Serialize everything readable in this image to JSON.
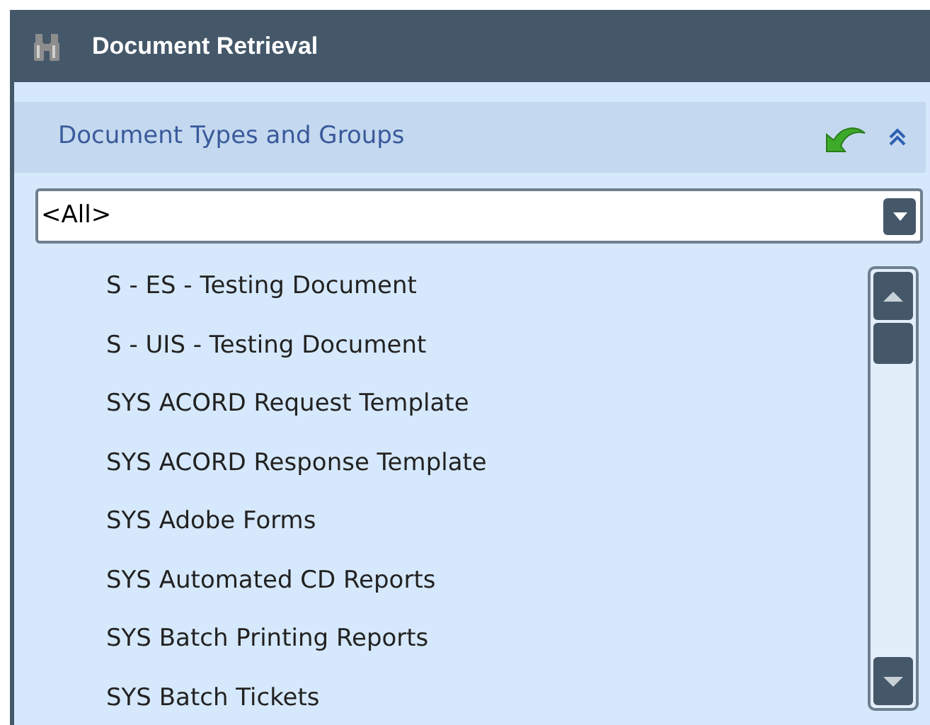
{
  "header": {
    "title": "Document Retrieval"
  },
  "section": {
    "title": "Document Types and Groups",
    "expanded": true
  },
  "filter": {
    "value": "<All>"
  },
  "items": [
    {
      "label": "S - ES - Testing Document"
    },
    {
      "label": "S - UIS - Testing Document"
    },
    {
      "label": "SYS ACORD Request Template"
    },
    {
      "label": "SYS ACORD Response Template"
    },
    {
      "label": "SYS Adobe Forms"
    },
    {
      "label": "SYS Automated CD Reports"
    },
    {
      "label": "SYS Batch Printing Reports"
    },
    {
      "label": "SYS Batch Tickets"
    }
  ]
}
